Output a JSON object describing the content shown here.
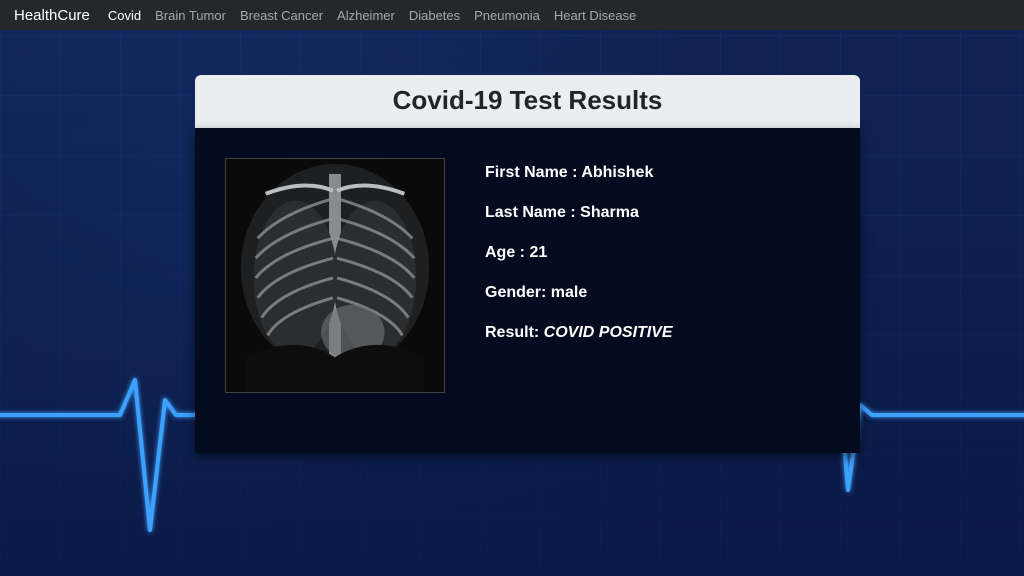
{
  "brand": "HealthCure",
  "nav": {
    "active": "Covid",
    "items": [
      "Covid",
      "Brain Tumor",
      "Breast Cancer",
      "Alzheimer",
      "Diabetes",
      "Pneumonia",
      "Heart Disease"
    ]
  },
  "card": {
    "title": "Covid-19 Test Results",
    "fields": {
      "first_name_label": "First Name : ",
      "first_name": "Abhishek",
      "last_name_label": "Last Name : ",
      "last_name": "Sharma",
      "age_label": "Age : ",
      "age": "21",
      "gender_label": "Gender: ",
      "gender": "male",
      "result_label": "Result: ",
      "result": "COVID POSITIVE"
    }
  }
}
